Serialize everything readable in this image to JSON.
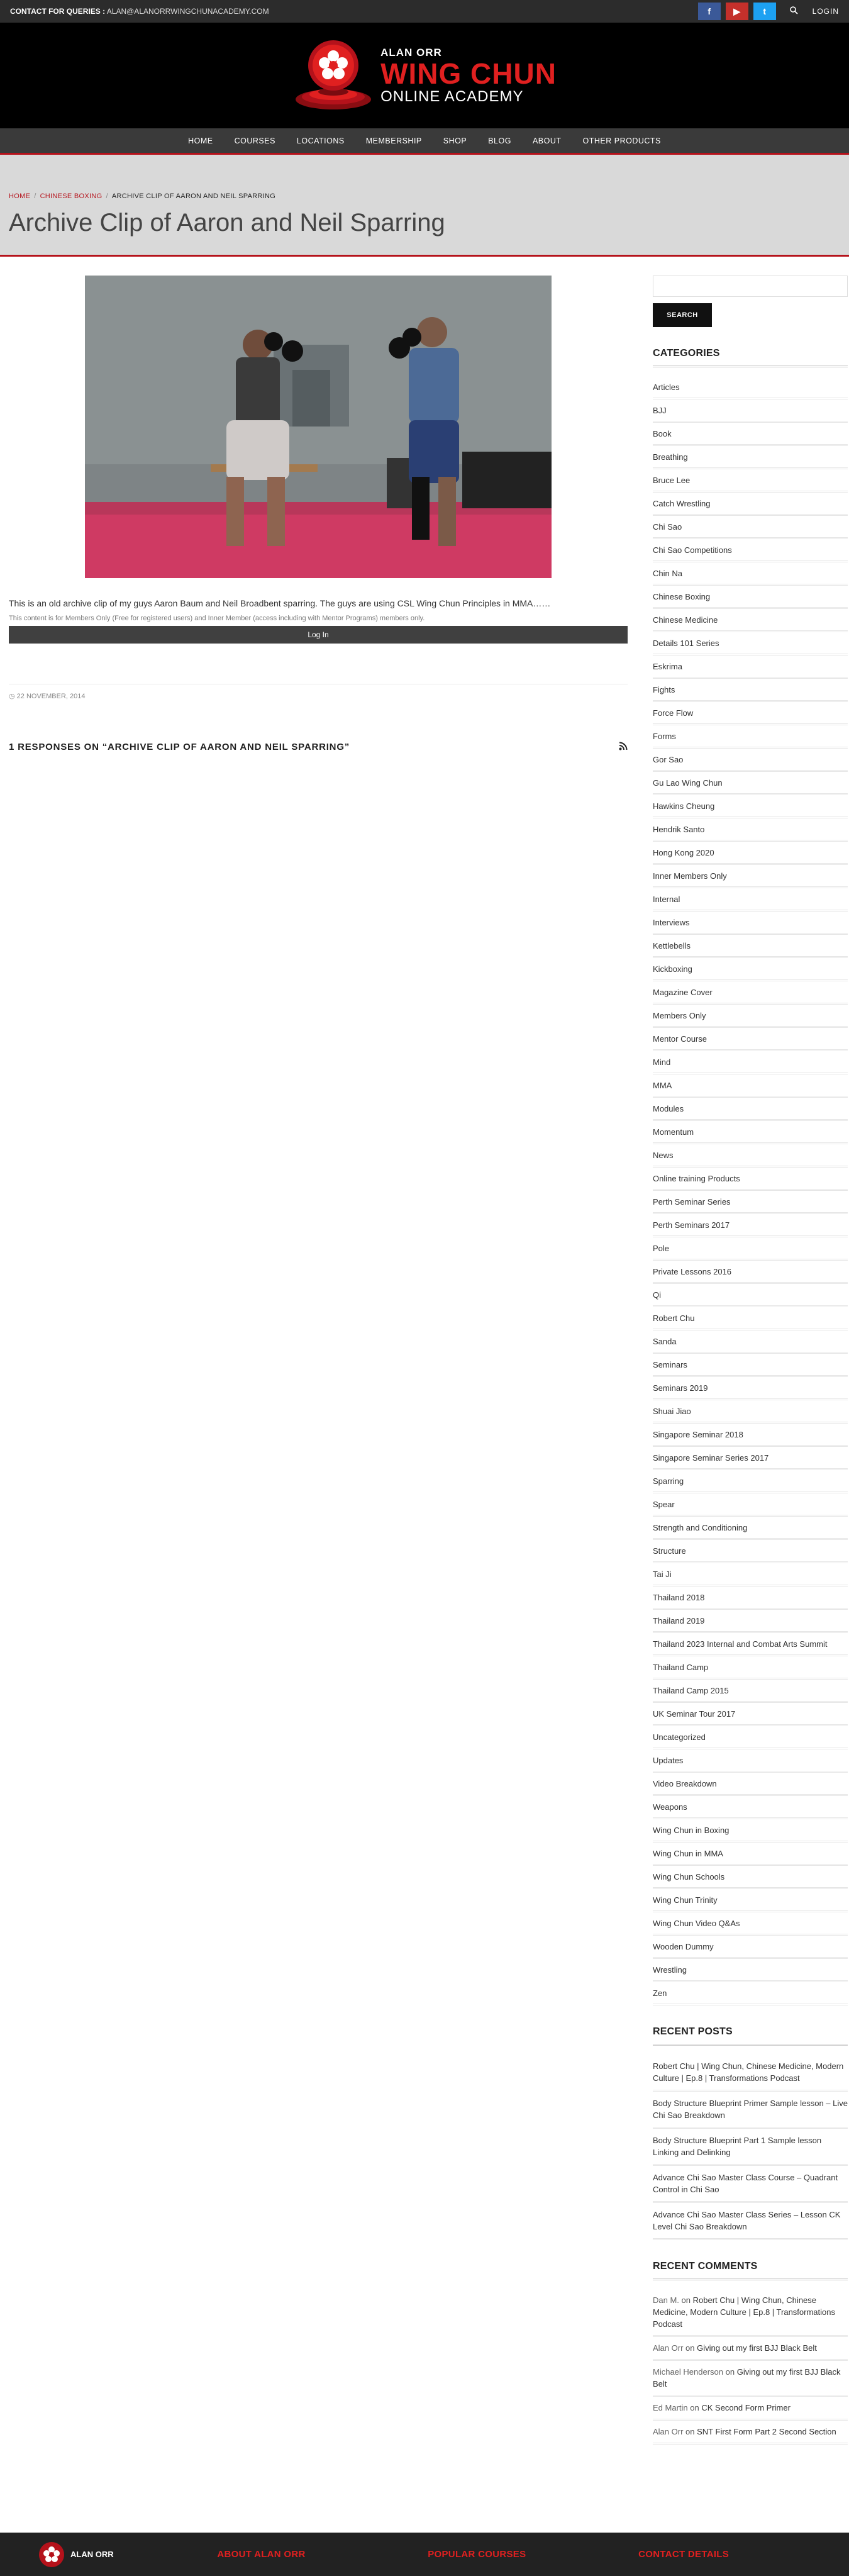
{
  "topbar": {
    "contact_label": "CONTACT FOR QUERIES :",
    "email": "ALAN@ALANORRWINGCHUNACADEMY.COM",
    "social": [
      "facebook-icon",
      "youtube-icon",
      "twitter-icon"
    ],
    "login_label": "LOGIN"
  },
  "logo": {
    "line1": "ALAN ORR",
    "line2": "WING CHUN",
    "line3": "ONLINE ACADEMY"
  },
  "nav": {
    "items": [
      "HOME",
      "COURSES",
      "LOCATIONS",
      "MEMBERSHIP",
      "SHOP",
      "BLOG",
      "ABOUT",
      "OTHER PRODUCTS"
    ]
  },
  "breadcrumb": {
    "home": "HOME",
    "category": "CHINESE BOXING",
    "current": "ARCHIVE CLIP OF AARON AND NEIL SPARRING"
  },
  "page_title": "Archive Clip of Aaron and Neil Sparring",
  "post": {
    "intro": "This is an old  archive clip of  my guys Aaron Baum and Neil Broadbent sparring. The guys are using CSL Wing Chun Principles in MMA……",
    "members_note": "This content is for Members Only (Free for registered users) and Inner Member (access including with Mentor Programs) members only.",
    "login_button": "Log In",
    "date": "22 NOVEMBER, 2014",
    "responses_heading": "1 RESPONSES ON “ARCHIVE CLIP OF AARON AND NEIL SPARRING”"
  },
  "sidebar": {
    "search_button": "SEARCH",
    "categories_title": "CATEGORIES",
    "categories": [
      "Articles",
      "BJJ",
      "Book",
      "Breathing",
      "Bruce Lee",
      "Catch Wrestling",
      "Chi Sao",
      "Chi Sao Competitions",
      "Chin Na",
      "Chinese Boxing",
      "Chinese Medicine",
      "Details 101 Series",
      "Eskrima",
      "Fights",
      "Force Flow",
      "Forms",
      "Gor Sao",
      "Gu Lao Wing Chun",
      "Hawkins Cheung",
      "Hendrik Santo",
      "Hong Kong 2020",
      "Inner Members Only",
      "Internal",
      "Interviews",
      "Kettlebells",
      "Kickboxing",
      "Magazine Cover",
      "Members Only",
      "Mentor Course",
      "Mind",
      "MMA",
      "Modules",
      "Momentum",
      "News",
      "Online training Products",
      "Perth Seminar Series",
      "Perth Seminars 2017",
      "Pole",
      "Private Lessons 2016",
      "Qi",
      "Robert Chu",
      "Sanda",
      "Seminars",
      "Seminars 2019",
      "Shuai Jiao",
      "Singapore Seminar 2018",
      "Singapore Seminar Series 2017",
      "Sparring",
      "Spear",
      "Strength and Conditioning",
      "Structure",
      "Tai Ji",
      "Thailand 2018",
      "Thailand 2019",
      "Thailand 2023 Internal and Combat Arts Summit",
      "Thailand Camp",
      "Thailand Camp 2015",
      "UK Seminar Tour 2017",
      "Uncategorized",
      "Updates",
      "Video Breakdown",
      "Weapons",
      "Wing Chun in Boxing",
      "Wing Chun in MMA",
      "Wing Chun Schools",
      "Wing Chun Trinity",
      "Wing Chun Video Q&As",
      "Wooden Dummy",
      "Wrestling",
      "Zen"
    ],
    "recent_posts_title": "RECENT POSTS",
    "recent_posts": [
      "Robert Chu | Wing Chun, Chinese Medicine, Modern Culture | Ep.8 | Transformations Podcast",
      "Body Structure Blueprint Primer Sample lesson – Live Chi Sao Breakdown",
      "Body Structure Blueprint Part 1 Sample lesson Linking and Delinking",
      "Advance Chi Sao Master Class Course – Quadrant Control in Chi Sao",
      "Advance Chi Sao Master Class Series – Lesson CK Level Chi Sao Breakdown"
    ],
    "recent_comments_title": "RECENT COMMENTS",
    "recent_comments": [
      {
        "author": "Dan M.",
        "on": "on",
        "post": "Robert Chu | Wing Chun, Chinese Medicine, Modern Culture | Ep.8 | Transformations Podcast"
      },
      {
        "author": "Alan Orr",
        "on": "on",
        "post": "Giving out my first BJJ Black Belt"
      },
      {
        "author": "Michael Henderson",
        "on": "on",
        "post": "Giving out my first BJJ Black Belt"
      },
      {
        "author": "Ed Martin",
        "on": "on",
        "post": "CK Second Form Primer"
      },
      {
        "author": "Alan Orr",
        "on": "on",
        "post": "SNT First Form Part 2 Second Section"
      }
    ]
  },
  "footer": {
    "logo_text": "ALAN ORR",
    "about_heading": "ABOUT ALAN ORR",
    "popular_heading": "POPULAR COURSES",
    "contact_heading": "CONTACT DETAILS"
  },
  "colors": {
    "accent": "#b5121b",
    "topbar": "#2c2c2c",
    "nav": "#3a3a3a",
    "titlebar": "#d9d9d9"
  }
}
